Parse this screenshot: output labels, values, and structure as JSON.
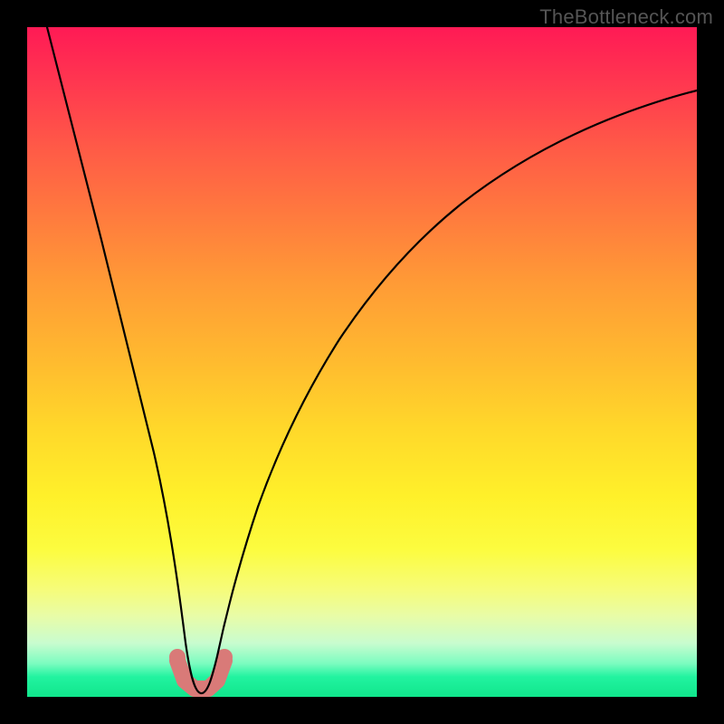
{
  "watermark": "TheBottleneck.com",
  "colors": {
    "background": "#000000",
    "curve": "#000000",
    "highlight": "#d97a78",
    "gradient_top": "#ff1a55",
    "gradient_bottom": "#10e68c"
  },
  "chart_data": {
    "type": "line",
    "title": "",
    "xlabel": "",
    "ylabel": "",
    "xlim": [
      0,
      100
    ],
    "ylim": [
      0,
      100
    ],
    "grid": false,
    "legend": false,
    "series": [
      {
        "name": "bottleneck-curve",
        "x": [
          3,
          5,
          8,
          10,
          12,
          14,
          16,
          18,
          20,
          22,
          23.5,
          25,
          26.5,
          28,
          30,
          32,
          35,
          38,
          42,
          46,
          50,
          55,
          60,
          65,
          70,
          75,
          80,
          85,
          90,
          95,
          100
        ],
        "y": [
          100,
          93,
          83,
          76,
          68,
          59,
          50,
          40,
          28,
          14,
          5,
          0,
          0,
          3,
          10,
          18,
          28,
          36,
          45,
          52,
          58,
          64,
          69,
          73,
          76,
          79,
          81,
          83,
          84.5,
          86,
          87
        ]
      }
    ],
    "annotations": [
      {
        "name": "optimal-range-highlight",
        "x_range": [
          22.5,
          29
        ],
        "y_range": [
          0,
          6
        ],
        "note": "pink thick segment near curve minimum"
      }
    ]
  }
}
